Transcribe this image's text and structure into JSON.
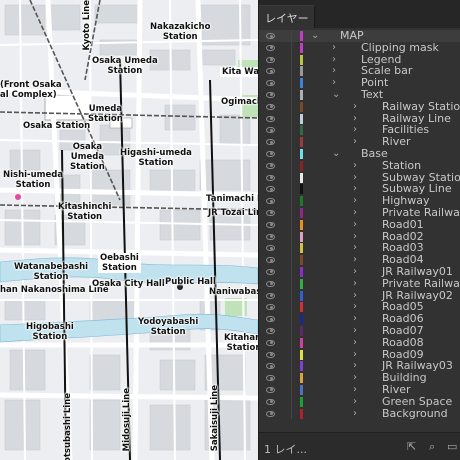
{
  "panel": {
    "tab_label": "レイヤー",
    "layers": [
      {
        "name": "MAP",
        "level": 0,
        "expanded": true,
        "color": "#c23cc4"
      },
      {
        "name": "Clipping mask",
        "level": 1,
        "expanded": false,
        "color": "#c23cc4"
      },
      {
        "name": "Legend",
        "level": 1,
        "expanded": false,
        "color": "#b9c640"
      },
      {
        "name": "Scale bar",
        "level": 1,
        "expanded": false,
        "color": "#9a9a9a"
      },
      {
        "name": "Point",
        "level": 1,
        "expanded": false,
        "color": "#4080d8"
      },
      {
        "name": "Text",
        "level": 1,
        "expanded": true,
        "color": "#b0b0b0"
      },
      {
        "name": "Railway Station",
        "level": 2,
        "expanded": false,
        "color": "#7a4a28"
      },
      {
        "name": "Railway Line",
        "level": 2,
        "expanded": false,
        "color": "#c0d0e0"
      },
      {
        "name": "Facilities",
        "level": 2,
        "expanded": false,
        "color": "#2f6a40"
      },
      {
        "name": "River",
        "level": 2,
        "expanded": false,
        "color": "#9c3b3b"
      },
      {
        "name": "Base",
        "level": 1,
        "expanded": true,
        "color": "#6fe0e8"
      },
      {
        "name": "Station",
        "level": 2,
        "expanded": false,
        "color": "#8a2222"
      },
      {
        "name": "Subway Station",
        "level": 2,
        "expanded": false,
        "color": "#e8e8e8"
      },
      {
        "name": "Subway Line",
        "level": 2,
        "expanded": false,
        "color": "#111111"
      },
      {
        "name": "Highway",
        "level": 2,
        "expanded": false,
        "color": "#1f7a2a"
      },
      {
        "name": "Private Railway",
        "level": 2,
        "expanded": false,
        "color": "#8a2a8a"
      },
      {
        "name": "Road01",
        "level": 2,
        "expanded": false,
        "color": "#e89020"
      },
      {
        "name": "Road02",
        "level": 2,
        "expanded": false,
        "color": "#e0a0c0"
      },
      {
        "name": "Road03",
        "level": 2,
        "expanded": false,
        "color": "#d4c040"
      },
      {
        "name": "Road04",
        "level": 2,
        "expanded": false,
        "color": "#7a4a28"
      },
      {
        "name": "JR Railway01",
        "level": 2,
        "expanded": false,
        "color": "#8a30c0"
      },
      {
        "name": "Private Railway",
        "level": 2,
        "expanded": false,
        "color": "#30b040"
      },
      {
        "name": "JR Railway02",
        "level": 2,
        "expanded": false,
        "color": "#3060d0"
      },
      {
        "name": "Road05",
        "level": 2,
        "expanded": false,
        "color": "#d03030"
      },
      {
        "name": "Road06",
        "level": 2,
        "expanded": false,
        "color": "#1a2a8a"
      },
      {
        "name": "Road07",
        "level": 2,
        "expanded": false,
        "color": "#5a2a6a"
      },
      {
        "name": "Road08",
        "level": 2,
        "expanded": false,
        "color": "#d040a0"
      },
      {
        "name": "Road09",
        "level": 2,
        "expanded": false,
        "color": "#e0e040"
      },
      {
        "name": "JR Railway03",
        "level": 2,
        "expanded": false,
        "color": "#8040d0"
      },
      {
        "name": "Building",
        "level": 2,
        "expanded": false,
        "color": "#e0a040"
      },
      {
        "name": "River",
        "level": 2,
        "expanded": false,
        "color": "#5070c0"
      },
      {
        "name": "Green Space",
        "level": 2,
        "expanded": false,
        "color": "#20a030"
      },
      {
        "name": "Background",
        "level": 2,
        "expanded": false,
        "color": "#b02030"
      }
    ],
    "footer": {
      "layer_count": "1 レイ..."
    }
  },
  "map": {
    "labels": {
      "kyoto_line": "Kyoto Line",
      "nakazakicho": "Nakazakicho\nStation",
      "osaka_umeda": "Osaka Umeda\nStation",
      "front_osaka": "(Front Osaka\nal Complex)",
      "kita_ward": "Kita Ward",
      "ogimachi": "Ogimachi",
      "umeda": "Umeda\nStation",
      "osaka_station": "Osaka Station",
      "osaka_umeda2": "Osaka\nUmeda\nStation",
      "higashi_umeda": "Higashi-umeda\nStation",
      "nishi_umeda": "Nishi-umeda\nStation",
      "kitashinchi": "Kitashinchi\nStation",
      "tanimachi": "Tanimachi Line",
      "tozai": "JR Tozai Line",
      "watanabebashi": "Watanabebashi\nStation",
      "oebashi": "Oebashi\nStation",
      "nakanoshima": "han Nakanoshima Line",
      "city_hall": "Osaka City Hall",
      "public_hall": "Public Hall",
      "naniwabashi": "Naniwabash",
      "yodoyabashi": "Yodoyabashi\nStation",
      "higobashi": "Higobashi\nStation",
      "kitahama": "Kitaham\nStation",
      "yotsubashi": "Yotsubashi Line",
      "midosuji": "Midosuji Line",
      "sakaisuji": "Sakaisuji Line"
    }
  }
}
